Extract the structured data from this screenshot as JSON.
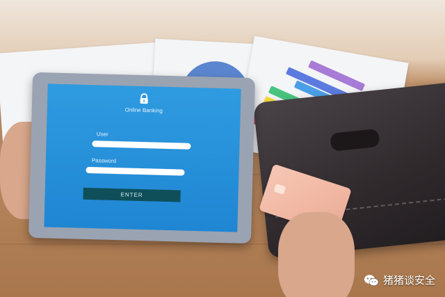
{
  "login_screen": {
    "title": "Online Banking",
    "user_label": "User",
    "password_label": "Password",
    "enter_label": "ENTER"
  },
  "watermark": {
    "text": "猪猪谈安全"
  },
  "icons": {
    "lock": "lock-icon",
    "watermark": "wechat-icon"
  },
  "colors": {
    "screen_blue": "#2f9be0",
    "enter_button": "#0f4f5a",
    "chart_bars": [
      "#a77bd6",
      "#5c7be0",
      "#4aa0e6",
      "#48c47e",
      "#f5dc3a",
      "#f58a3a",
      "#e8506b"
    ]
  }
}
